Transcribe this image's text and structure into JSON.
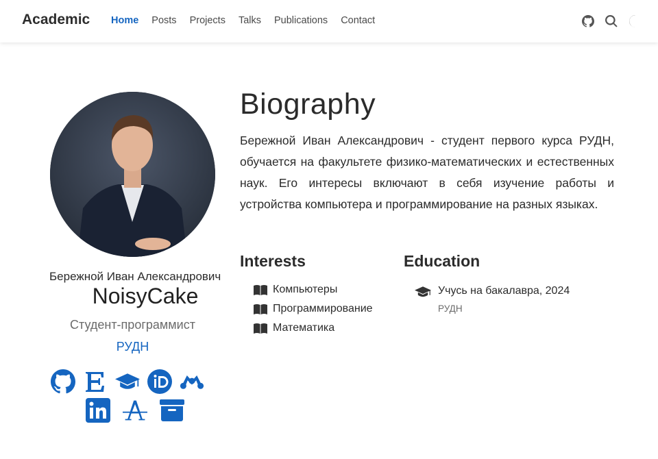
{
  "navbar": {
    "brand": "Academic",
    "links": [
      "Home",
      "Posts",
      "Projects",
      "Talks",
      "Publications",
      "Contact"
    ],
    "active": "Home",
    "icons": [
      "github-icon",
      "search-icon",
      "moon-icon"
    ]
  },
  "profile": {
    "full_name": "Бережной Иван Александрович",
    "nickname": "NoisyCake",
    "role": "Студент-программист",
    "organization": "РУДН",
    "social_icons": [
      "github-icon",
      "elibrary-icon",
      "graduation-cap-icon",
      "orcid-icon",
      "mendeley-icon",
      "linkedin-icon",
      "academia-icon",
      "archive-icon"
    ]
  },
  "biography": {
    "title": "Biography",
    "text": "Бережной Иван Александрович - студент первого курса РУДН, обучается на факультете физико-математических и естественных наук. Его интересы включают в себя изучение работы и устройства компьютера и программирование на разных языках."
  },
  "interests": {
    "title": "Interests",
    "items": [
      "Компьютеры",
      "Программирование",
      "Математика"
    ]
  },
  "education": {
    "title": "Education",
    "items": [
      {
        "course": "Учусь на бакалавра, 2024",
        "institution": "РУДН"
      }
    ]
  },
  "colors": {
    "accent": "#1565c0",
    "text": "#2b2b2b"
  }
}
